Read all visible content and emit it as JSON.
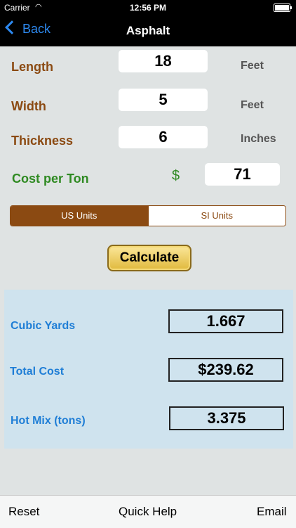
{
  "status_bar": {
    "carrier": "Carrier",
    "time": "12:56 PM",
    "wifi_icon": "wifi-icon",
    "battery_icon": "battery-icon"
  },
  "nav": {
    "back_label": "Back",
    "title": "Asphalt"
  },
  "inputs": {
    "length": {
      "label": "Length",
      "value": "18",
      "unit": "Feet"
    },
    "width": {
      "label": "Width",
      "value": "5",
      "unit": "Feet"
    },
    "thickness": {
      "label": "Thickness",
      "value": "6",
      "unit": "Inches"
    },
    "cost": {
      "label": "Cost per Ton",
      "currency": "$",
      "value": "71"
    }
  },
  "units": {
    "options": [
      "US Units",
      "SI Units"
    ],
    "selected": "US Units"
  },
  "calculate_label": "Calculate",
  "results": {
    "cubic_yards": {
      "label": "Cubic Yards",
      "value": "1.667"
    },
    "total_cost": {
      "label": "Total Cost",
      "value": "$239.62"
    },
    "hot_mix": {
      "label": "Hot Mix (tons)",
      "value": "3.375"
    }
  },
  "toolbar": {
    "reset": "Reset",
    "quick_help": "Quick Help",
    "email": "Email"
  },
  "colors": {
    "label_brown": "#8b4a12",
    "label_green": "#2f8a22",
    "result_blue": "#1f7ed6",
    "results_bg": "#cfe3ee"
  }
}
